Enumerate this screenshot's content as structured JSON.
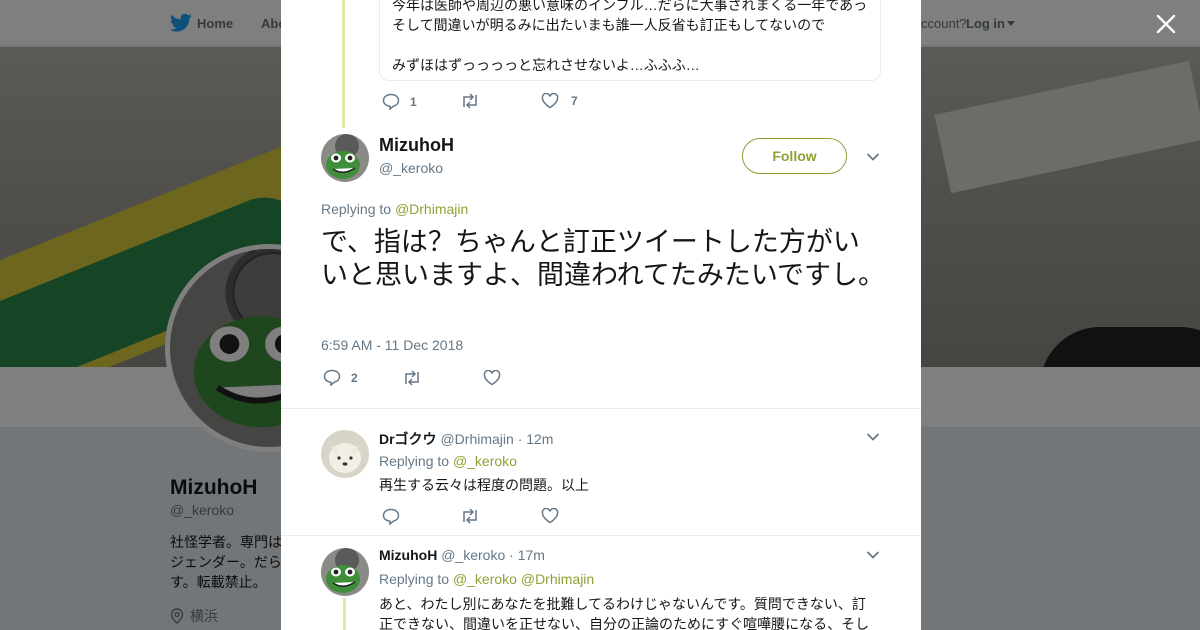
{
  "nav": {
    "home_label": "Home",
    "about_label": "Abo",
    "account_prompt": "ccount?",
    "login_label": "Log in"
  },
  "profile": {
    "name": "MizuhoH",
    "handle": "@_keroko",
    "bio": "社怪学者。専門は\nジェンダー。だら\nす。転載禁止。",
    "location": "横浜"
  },
  "colors": {
    "link": "#8fa136",
    "muted": "#657786",
    "thread_line": "#e1e8a8"
  },
  "quoted_tweet": {
    "line1": "今年は医師や周辺の悪い意味のインフル…だらに大事されまくる一年であった。",
    "line2": "そして間違いが明るみに出たいまも誰一人反省も訂正もしてないので",
    "line3": "",
    "line4": "みずほはずっっっっと忘れさせないよ…ふふふ…",
    "reply_count": "1",
    "retweet_count": "",
    "like_count": "7"
  },
  "main_tweet": {
    "name": "MizuhoH",
    "handle": "@_keroko",
    "follow_label": "Follow",
    "replying_prefix": "Replying to",
    "replying_to": "@Drhimajin",
    "text": "で、指は？ちゃんと訂正ツイートした方がいいと思いますよ、間違われてたみたいですし。",
    "timestamp": "6:59 AM - 11 Dec 2018",
    "reply_count": "2",
    "retweet_count": "",
    "like_count": ""
  },
  "replies": [
    {
      "name": "Drゴクウ",
      "handle": "@Drhimajin",
      "time": "· 12m",
      "replying_prefix": "Replying to",
      "replying_to": "@_keroko",
      "replying_to_2": "",
      "text": "再生する云々は程度の問題。以上",
      "text2": ""
    },
    {
      "name": "MizuhoH",
      "handle": "@_keroko",
      "time": "· 17m",
      "replying_prefix": "Replying to",
      "replying_to": "@_keroko",
      "replying_to_2": "@Drhimajin",
      "text": "あと、わたし別にあなたを批難してるわけじゃないんです。質問できない、訂",
      "text2": "正できない、間違いを正せない、自分の正論のためにすぐ喧嘩腰になる、そし"
    }
  ],
  "icons": [
    "twitter-bird-icon",
    "close-icon",
    "reply-icon",
    "retweet-icon",
    "like-icon",
    "chevron-down-icon",
    "location-pin-icon"
  ]
}
